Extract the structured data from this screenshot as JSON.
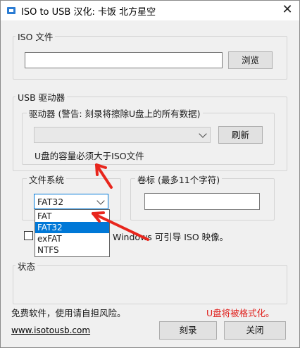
{
  "app": {
    "title": "ISO to USB  汉化: 卡饭 北方星空",
    "icon": "usb-app-icon",
    "close_glyph": "✕"
  },
  "iso_group": {
    "label": "ISO 文件",
    "path_value": "",
    "browse_label": "浏览"
  },
  "usb_group": {
    "label": "USB 驱动器",
    "drive_label": "驱动器 (警告: 刻录将擦除U盘上的所有数据)",
    "drive_value": "",
    "refresh_label": "刷新",
    "capacity_note": "U盘的容量必须大于ISO文件"
  },
  "fs_group": {
    "label": "文件系统",
    "selected": "FAT32",
    "options": [
      "FAT",
      "FAT32",
      "exFAT",
      "NTFS"
    ],
    "selected_index": 1
  },
  "volume_group": {
    "label": "卷标 (最多11个字符)",
    "value": ""
  },
  "bootable": {
    "checked": false,
    "label": "Windows 可引导 ISO 映像。"
  },
  "status_group": {
    "label": "状态",
    "text": ""
  },
  "footer": {
    "disclaimer": "免费软件，使用请自担风险。",
    "warning": "U盘将被格式化。",
    "website": "www.isotousb.com",
    "burn_label": "刻录",
    "close_label": "关闭"
  },
  "colors": {
    "accent": "#0078d7",
    "warning_red": "#e0201c",
    "annotation_arrow": "#e8261d"
  }
}
